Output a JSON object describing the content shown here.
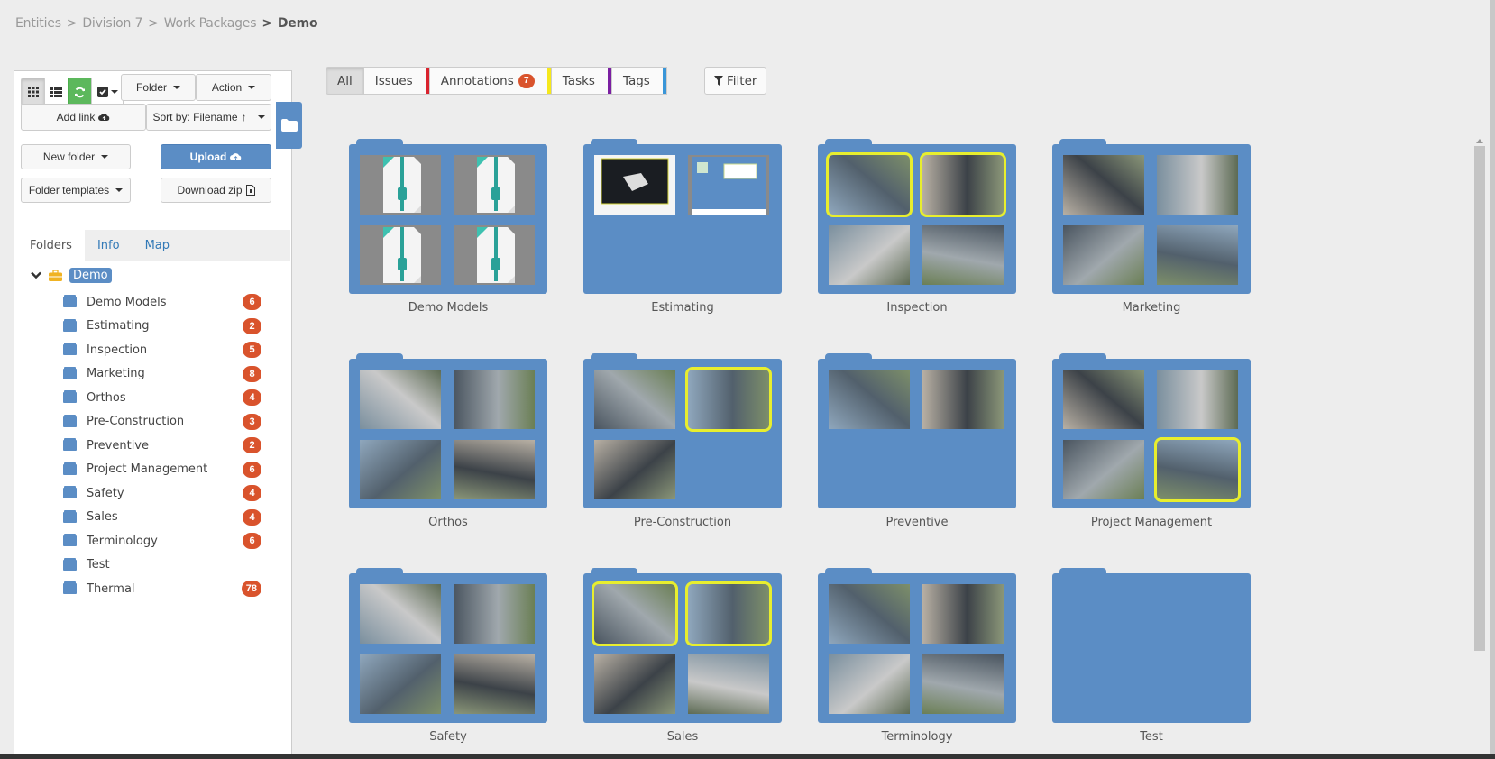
{
  "breadcrumb": {
    "items": [
      "Entities",
      "Division 7",
      "Work Packages"
    ],
    "current": "Demo",
    "separator": ">"
  },
  "toolbar": {
    "view_buttons": [
      "grid-view",
      "list-view",
      "refresh",
      "select"
    ],
    "folder_label": "Folder",
    "action_label": "Action",
    "add_link_label": "Add link",
    "sort_label": "Sort by: Filename",
    "new_folder_label": "New folder",
    "upload_label": "Upload",
    "folder_templates_label": "Folder templates",
    "download_zip_label": "Download zip"
  },
  "panel_tabs": [
    {
      "label": "Folders",
      "active": true
    },
    {
      "label": "Info",
      "active": false
    },
    {
      "label": "Map",
      "active": false
    }
  ],
  "tree": {
    "root": "Demo",
    "items": [
      {
        "label": "Demo Models",
        "count": "6"
      },
      {
        "label": "Estimating",
        "count": "2"
      },
      {
        "label": "Inspection",
        "count": "5"
      },
      {
        "label": "Marketing",
        "count": "8"
      },
      {
        "label": "Orthos",
        "count": "4"
      },
      {
        "label": "Pre-Construction",
        "count": "3"
      },
      {
        "label": "Preventive",
        "count": "2"
      },
      {
        "label": "Project Management",
        "count": "6"
      },
      {
        "label": "Safety",
        "count": "4"
      },
      {
        "label": "Sales",
        "count": "4"
      },
      {
        "label": "Terminology",
        "count": "6"
      },
      {
        "label": "Test",
        "count": null
      },
      {
        "label": "Thermal",
        "count": "78"
      }
    ]
  },
  "filters": [
    {
      "label": "All",
      "active": true,
      "color": null,
      "badge": null
    },
    {
      "label": "Issues",
      "active": false,
      "color": "#d9232e",
      "badge": null
    },
    {
      "label": "Annotations",
      "active": false,
      "color": "#f5e81c",
      "badge": "7"
    },
    {
      "label": "Tasks",
      "active": false,
      "color": "#7b1fa2",
      "badge": null
    },
    {
      "label": "Tags",
      "active": false,
      "color": "#3a96d8",
      "badge": null
    }
  ],
  "filter_button_label": "Filter",
  "colors": {
    "accent": "#5b8dc5",
    "badge": "#d9532c",
    "highlight": "#e8ee2e",
    "success": "#5cb85c"
  },
  "folders": [
    {
      "name": "Demo Models",
      "thumbs": [
        "zip",
        "zip",
        "zip",
        "zip"
      ],
      "highlight": [
        false,
        false,
        false,
        false
      ]
    },
    {
      "name": "Estimating",
      "thumbs": [
        "doc-dark",
        "doc-light"
      ],
      "highlight": [
        false,
        false
      ]
    },
    {
      "name": "Inspection",
      "thumbs": [
        "photo",
        "photo",
        "photo",
        "photo"
      ],
      "highlight": [
        true,
        true,
        false,
        false
      ]
    },
    {
      "name": "Marketing",
      "thumbs": [
        "photo",
        "photo",
        "photo",
        "photo"
      ],
      "highlight": [
        false,
        false,
        false,
        false
      ]
    },
    {
      "name": "Orthos",
      "thumbs": [
        "photo",
        "photo",
        "photo",
        "photo"
      ],
      "highlight": [
        false,
        false,
        false,
        false
      ]
    },
    {
      "name": "Pre-Construction",
      "thumbs": [
        "photo",
        "photo",
        "photo"
      ],
      "highlight": [
        false,
        true,
        false
      ]
    },
    {
      "name": "Preventive",
      "thumbs": [
        "photo",
        "photo"
      ],
      "highlight": [
        false,
        false
      ]
    },
    {
      "name": "Project Management",
      "thumbs": [
        "photo",
        "photo",
        "photo",
        "photo"
      ],
      "highlight": [
        false,
        false,
        false,
        true
      ]
    },
    {
      "name": "Safety",
      "thumbs": [
        "photo",
        "photo",
        "photo",
        "photo"
      ],
      "highlight": [
        false,
        false,
        false,
        false
      ]
    },
    {
      "name": "Sales",
      "thumbs": [
        "photo",
        "photo",
        "photo",
        "photo"
      ],
      "highlight": [
        true,
        true,
        false,
        false
      ]
    },
    {
      "name": "Terminology",
      "thumbs": [
        "photo",
        "photo",
        "photo",
        "photo"
      ],
      "highlight": [
        false,
        false,
        false,
        false
      ]
    },
    {
      "name": "Test",
      "thumbs": [],
      "highlight": []
    }
  ]
}
